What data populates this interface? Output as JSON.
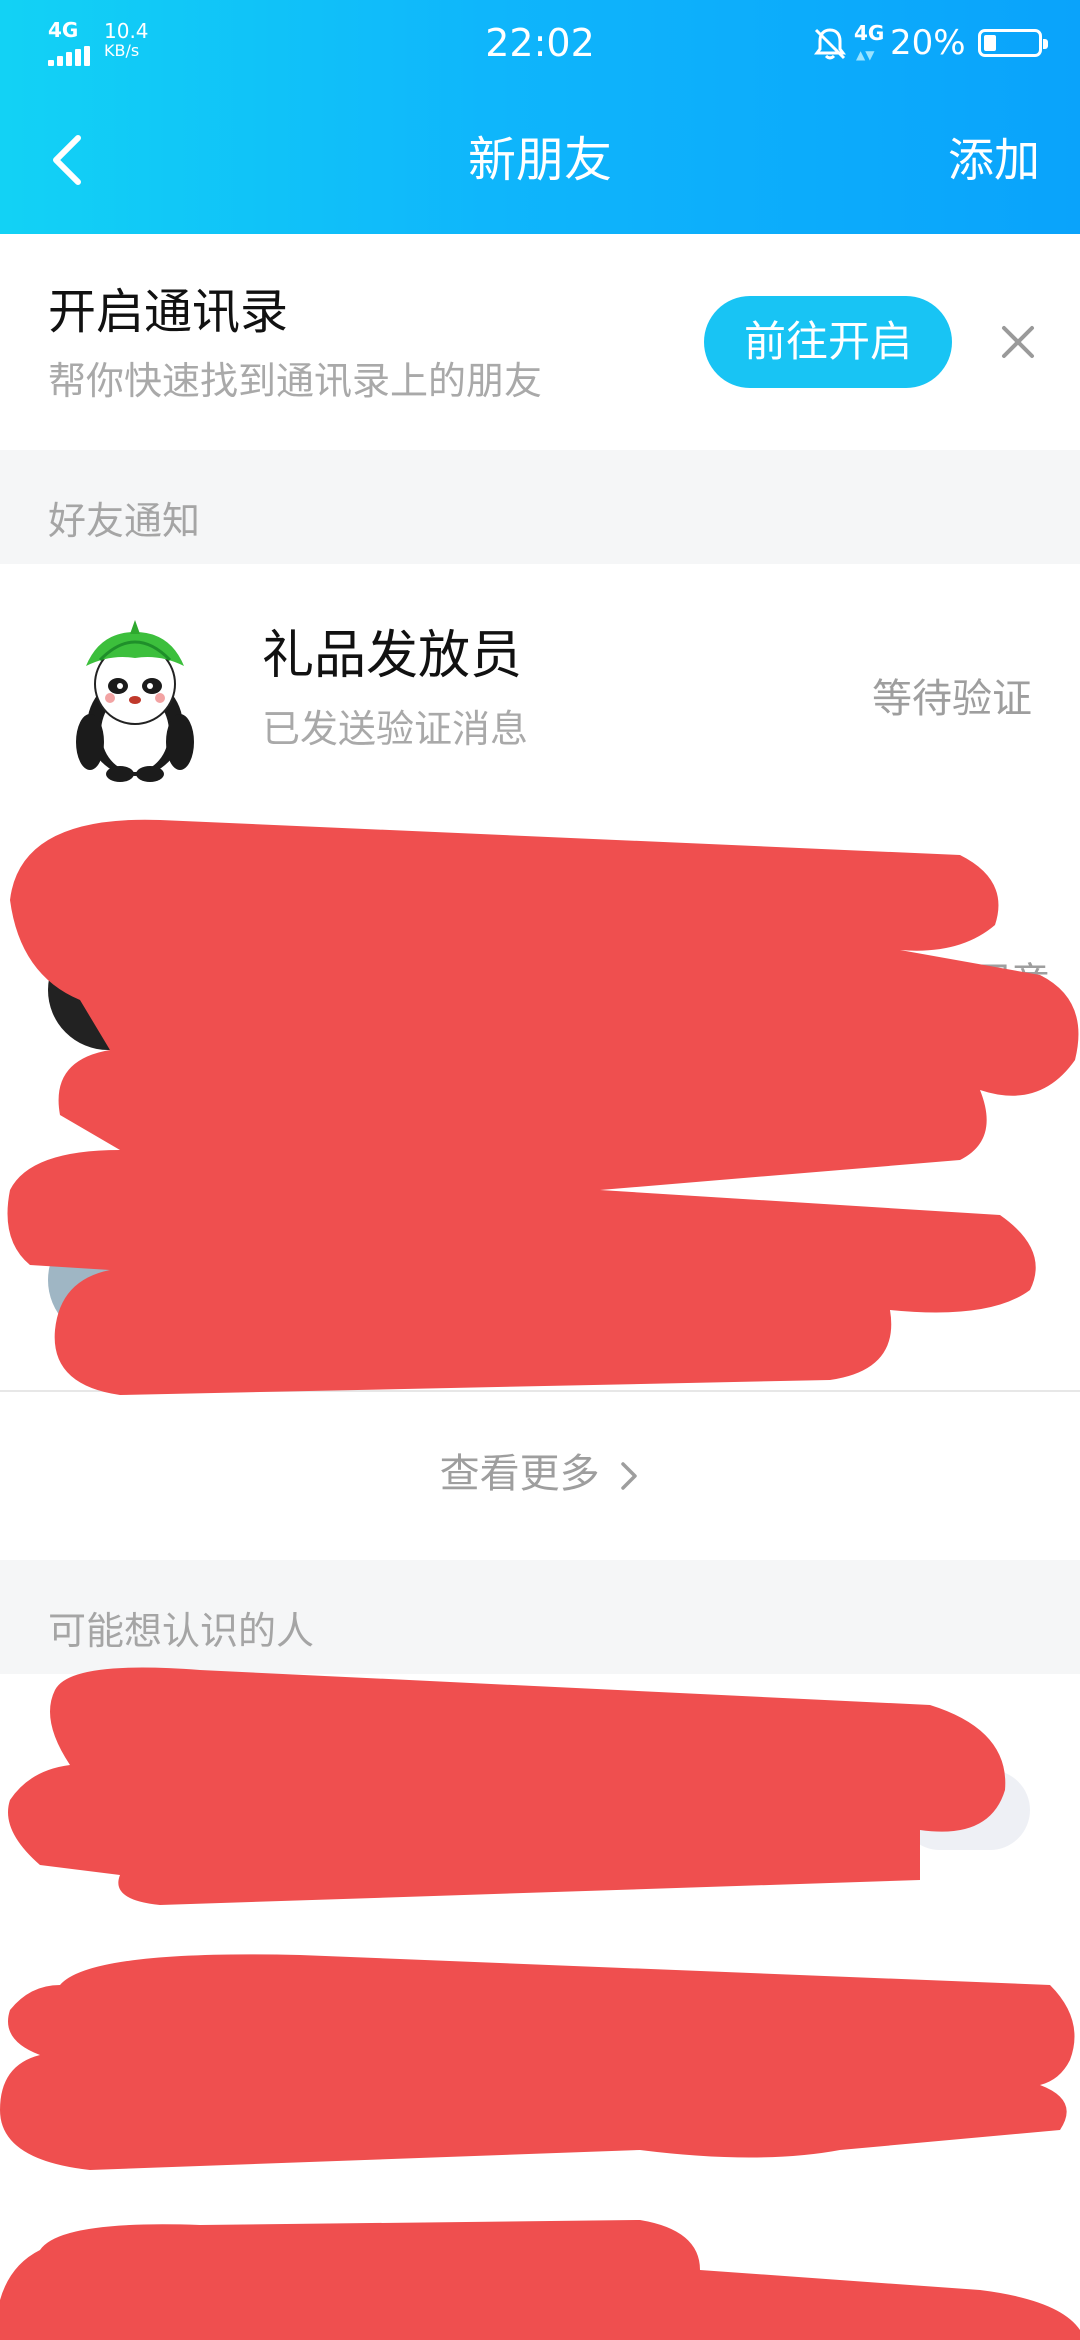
{
  "status_bar": {
    "signal_label": "4G",
    "speed_value": "10.4",
    "speed_unit": "KB/s",
    "time": "22:02",
    "network_label": "4G",
    "battery_percent": "20%",
    "battery_level": 0.2,
    "icons": [
      "signal-icon",
      "bell-off-icon",
      "battery-icon"
    ]
  },
  "navbar": {
    "back_icon": "chevron-left-icon",
    "title": "新朋友",
    "add_label": "添加"
  },
  "contacts_banner": {
    "title": "开启通讯录",
    "subtitle": "帮你快速找到通讯录上的朋友",
    "button_label": "前往开启",
    "close_icon": "close-icon"
  },
  "friend_notifications": {
    "section_label": "好友通知",
    "items": [
      {
        "name": "礼品发放员",
        "subtitle": "已发送验证消息",
        "status": "等待验证",
        "avatar_icon": "panda-avatar"
      }
    ],
    "partial_visible_text": "同意",
    "see_more_label": "查看更多"
  },
  "people_you_may_know": {
    "section_label": "可能想认识的人"
  },
  "colors": {
    "header_gradient_start": "#12d2f5",
    "header_gradient_end": "#0aa3fb",
    "accent_button": "#18c4f4",
    "redaction": "#ef4f4f"
  }
}
